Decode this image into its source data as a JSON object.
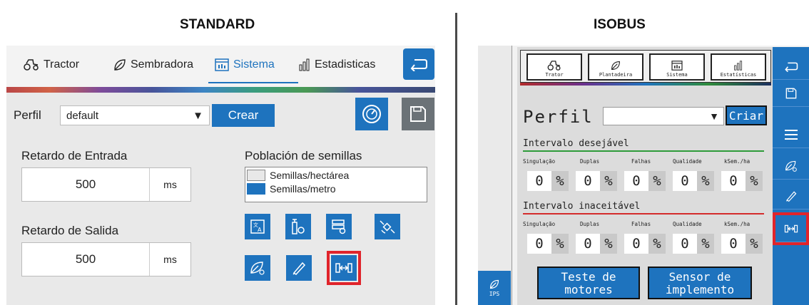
{
  "headings": {
    "standard": "STANDARD",
    "isobus": "ISOBUS"
  },
  "standard": {
    "tabs": [
      {
        "label": "Tractor",
        "icon": "tractor-icon"
      },
      {
        "label": "Sembradora",
        "icon": "leaf-icon"
      },
      {
        "label": "Sistema",
        "icon": "system-icon",
        "active": true
      },
      {
        "label": "Estadisticas",
        "icon": "stats-icon"
      }
    ],
    "perfil_label": "Perfil",
    "perfil_value": "default",
    "crear_label": "Crear",
    "retardo_entrada_label": "Retardo de Entrada",
    "retardo_entrada_value": "500",
    "retardo_entrada_unit": "ms",
    "retardo_salida_label": "Retardo de Salida",
    "retardo_salida_value": "500",
    "retardo_salida_unit": "ms",
    "poblacion_label": "Población de semillas",
    "poblacion_options": [
      "Semillas/hectárea",
      "Semillas/metro"
    ],
    "poblacion_selected": "Semillas/metro",
    "tool_icons": [
      "language-icon",
      "implement-settings-icon",
      "config-icon",
      "satellite-icon",
      "seed-settings-icon",
      "calibration-icon",
      "sensor-icon"
    ],
    "highlighted_icon": "sensor-icon",
    "colors": {
      "accent": "#1e73be",
      "highlight": "#e0242b"
    }
  },
  "isobus": {
    "tabs": [
      {
        "label": "Trator",
        "icon": "tractor-icon"
      },
      {
        "label": "Plantadeira",
        "icon": "leaf-icon"
      },
      {
        "label": "Sistema",
        "icon": "system-icon"
      },
      {
        "label": "Estatísticas",
        "icon": "stats-icon"
      }
    ],
    "perfil_label": "Perfil",
    "criar_label": "Criar",
    "intervalo_desejavel": "Intervalo desejável",
    "intervalo_inaceitavel": "Intervalo inaceitável",
    "columns": [
      "Singulação",
      "Duplas",
      "Falhas",
      "Qualidade",
      "kSem./ha"
    ],
    "desejavel_values": [
      "0",
      "0",
      "0",
      "0",
      "0"
    ],
    "inaceitavel_values": [
      "0",
      "0",
      "0",
      "0",
      "0"
    ],
    "percent_sign": "%",
    "teste_motores": "Teste de motores",
    "sensor_implemento": "Sensor de implemento",
    "ips_label": "IPS",
    "side_icons": [
      "back-icon",
      "save-icon",
      "menu-icon",
      "seed-settings-icon",
      "calibration-icon",
      "sensor-icon"
    ],
    "highlighted_icon": "sensor-icon"
  }
}
